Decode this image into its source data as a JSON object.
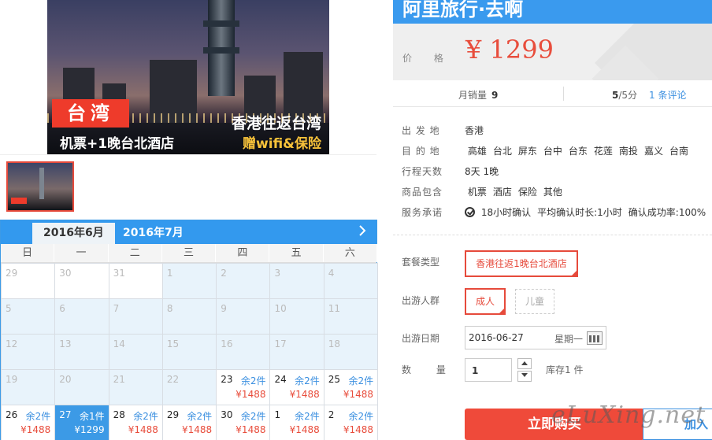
{
  "hero": {
    "tag": "台湾",
    "caption_left": "机票+1晚台北酒店",
    "caption_right_1": "香港往返台湾",
    "caption_right_2": "赠wifi&保险"
  },
  "calendar": {
    "tabs": [
      "2016年6月",
      "2016年7月"
    ],
    "weekdays": [
      "日",
      "一",
      "二",
      "三",
      "四",
      "五",
      "六"
    ],
    "rows": [
      [
        {
          "d": "29",
          "s": "w"
        },
        {
          "d": "30",
          "s": "w"
        },
        {
          "d": "31",
          "s": "w"
        },
        {
          "d": "1",
          "s": "b"
        },
        {
          "d": "2",
          "s": "b"
        },
        {
          "d": "3",
          "s": "b"
        },
        {
          "d": "4",
          "s": "b"
        }
      ],
      [
        {
          "d": "5",
          "s": "b"
        },
        {
          "d": "6",
          "s": "b"
        },
        {
          "d": "7",
          "s": "b"
        },
        {
          "d": "8",
          "s": "b"
        },
        {
          "d": "9",
          "s": "b"
        },
        {
          "d": "10",
          "s": "b"
        },
        {
          "d": "11",
          "s": "b"
        }
      ],
      [
        {
          "d": "12",
          "s": "b"
        },
        {
          "d": "13",
          "s": "b"
        },
        {
          "d": "14",
          "s": "b"
        },
        {
          "d": "15",
          "s": "b"
        },
        {
          "d": "16",
          "s": "b"
        },
        {
          "d": "17",
          "s": "b"
        },
        {
          "d": "18",
          "s": "b"
        }
      ],
      [
        {
          "d": "19",
          "s": "b"
        },
        {
          "d": "20",
          "s": "b"
        },
        {
          "d": "21",
          "s": "b"
        },
        {
          "d": "22",
          "s": "b"
        },
        {
          "d": "23",
          "s": "a",
          "r": "余2件",
          "p": "¥1488"
        },
        {
          "d": "24",
          "s": "a",
          "r": "余2件",
          "p": "¥1488"
        },
        {
          "d": "25",
          "s": "a",
          "r": "余2件",
          "p": "¥1488"
        }
      ],
      [
        {
          "d": "26",
          "s": "a",
          "r": "余2件",
          "p": "¥1488"
        },
        {
          "d": "27",
          "s": "sel",
          "r": "余1件",
          "p": "¥1299"
        },
        {
          "d": "28",
          "s": "a",
          "r": "余2件",
          "p": "¥1488"
        },
        {
          "d": "29",
          "s": "a",
          "r": "余2件",
          "p": "¥1488"
        },
        {
          "d": "30",
          "s": "a",
          "r": "余2件",
          "p": "¥1488"
        },
        {
          "d": "1",
          "s": "a",
          "r": "余2件",
          "p": "¥1488"
        },
        {
          "d": "2",
          "s": "a",
          "r": "余2件",
          "p": "¥1488"
        }
      ]
    ]
  },
  "product": {
    "brand": "阿里旅行·去啊",
    "price_label": "价 格",
    "price": "¥ 1299",
    "monthly_sales_label": "月销量",
    "monthly_sales": "9",
    "score": "5",
    "score_suffix": "/5分",
    "reviews": "1 条评论"
  },
  "info": {
    "depart_label": "出 发 地",
    "depart": "香港",
    "dest_label": "目 的 地",
    "dests": [
      "高雄",
      "台北",
      "屏东",
      "台中",
      "台东",
      "花莲",
      "南投",
      "嘉义",
      "台南"
    ],
    "days_label": "行程天数",
    "days": "8天 1晚",
    "includes_label": "商品包含",
    "includes": [
      "机票",
      "酒店",
      "保险",
      "其他"
    ],
    "promise_label": "服务承诺",
    "promises": [
      "18小时确认",
      "平均确认时长:1小时",
      "确认成功率:100%"
    ]
  },
  "options": {
    "package_label": "套餐类型",
    "package_value": "香港往返1晚台北酒店",
    "people_label": "出游人群",
    "adult": "成人",
    "child": "儿童",
    "date_label": "出游日期",
    "date_value": "2016-06-27",
    "weekday": "星期一",
    "qty_label": "数 量",
    "qty": "1",
    "stock": "库存1 件",
    "buy": "立即购买",
    "cart": "加入",
    "check_mark": "✓"
  },
  "watermark": "eLuXing.net"
}
